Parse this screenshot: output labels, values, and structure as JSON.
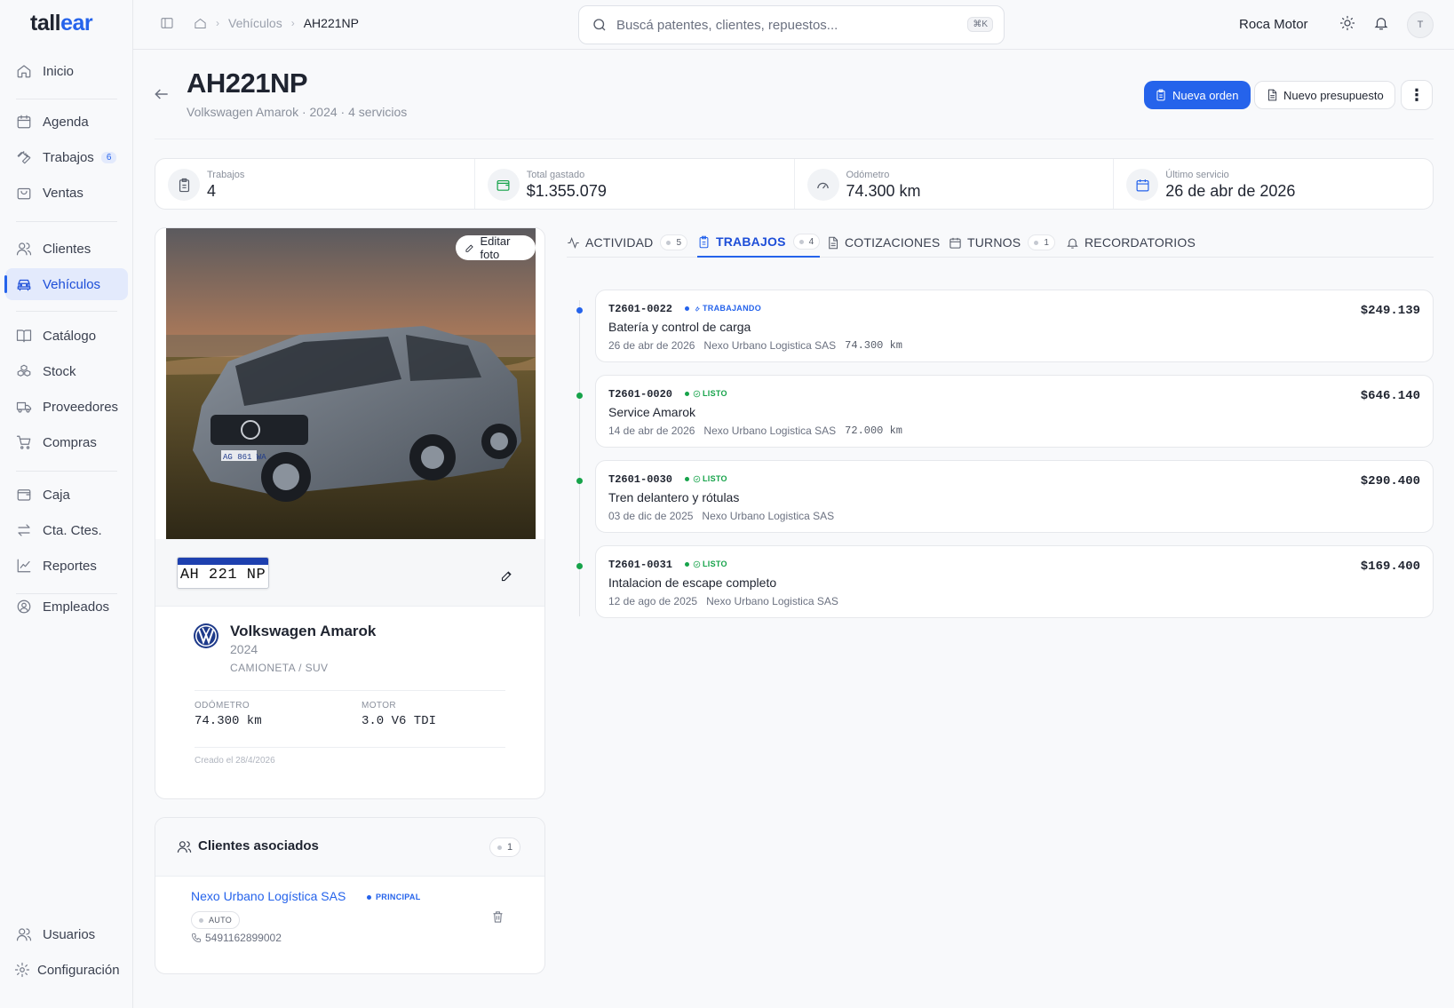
{
  "app": {
    "logo_main": "tallear",
    "logo_prefix": "tall",
    "logo_accent": "ear"
  },
  "colors": {
    "accent": "#2563eb",
    "success": "#16a34a",
    "working": "#2563eb"
  },
  "sidebar": {
    "items": [
      {
        "label": "Inicio",
        "icon": "home-icon"
      },
      {
        "label": "Agenda",
        "icon": "calendar-icon"
      },
      {
        "label": "Trabajos",
        "icon": "wrench-icon",
        "badge": "6"
      },
      {
        "label": "Ventas",
        "icon": "bag-icon"
      },
      {
        "label": "Clientes",
        "icon": "users-icon"
      },
      {
        "label": "Vehículos",
        "icon": "car-icon",
        "active": true
      },
      {
        "label": "Catálogo",
        "icon": "book-icon"
      },
      {
        "label": "Stock",
        "icon": "boxes-icon"
      },
      {
        "label": "Proveedores",
        "icon": "truck-icon"
      },
      {
        "label": "Compras",
        "icon": "cart-icon"
      },
      {
        "label": "Caja",
        "icon": "wallet-icon"
      },
      {
        "label": "Cta. Ctes.",
        "icon": "arrows-icon"
      },
      {
        "label": "Reportes",
        "icon": "chart-icon"
      },
      {
        "label": "Empleados",
        "icon": "user-circle-icon"
      },
      {
        "label": "Usuarios",
        "icon": "users-icon"
      },
      {
        "label": "Configuración",
        "icon": "gear-icon"
      }
    ]
  },
  "topbar": {
    "breadcrumb": {
      "section": "Vehículos",
      "current": "AH221NP"
    },
    "search": {
      "placeholder": "Buscá patentes, clientes, repuestos...",
      "shortcut": "⌘K"
    },
    "workshop": "Roca Motor",
    "avatar_initial": "T"
  },
  "header": {
    "title": "AH221NP",
    "subtitle": "Volkswagen Amarok · 2024 · 4 servicios",
    "new_order": "Nueva orden",
    "new_quote": "Nuevo presupuesto",
    "more": "⋮"
  },
  "stats": [
    {
      "label": "Trabajos",
      "value": "4",
      "icon": "clipboard-icon"
    },
    {
      "label": "Total gastado",
      "value": "$1.355.079",
      "icon": "wallet-icon"
    },
    {
      "label": "Odómetro",
      "value": "74.300 km",
      "icon": "gauge-icon"
    },
    {
      "label": "Último servicio",
      "value": "26 de abr de 2026",
      "icon": "calendar-icon"
    }
  ],
  "vehicle": {
    "edit_photo": "Editar foto",
    "plate": "AH 221 NP",
    "plate_header": "REPÚBLICA ARGENTINA",
    "photo_plate": "AG 861 WA",
    "brand_logo": "volkswagen-logo",
    "name": "Volkswagen Amarok",
    "year": "2024",
    "type": "CAMIONETA / SUV",
    "odometer_label": "ODÓMETRO",
    "odometer_value": "74.300 km",
    "engine_label": "MOTOR",
    "engine_value": "3.0 V6 TDI",
    "created": "Creado el 28/4/2026"
  },
  "clients": {
    "title": "Clientes asociados",
    "count": "1",
    "items": [
      {
        "name": "Nexo Urbano Logística SAS",
        "badge": "PRINCIPAL",
        "tag": "AUTO",
        "phone": "5491162899002"
      }
    ]
  },
  "tabs": [
    {
      "label": "ACTIVIDAD",
      "count": "5",
      "icon": "activity-icon"
    },
    {
      "label": "TRABAJOS",
      "count": "4",
      "icon": "clipboard-icon",
      "active": true
    },
    {
      "label": "COTIZACIONES",
      "icon": "document-icon"
    },
    {
      "label": "TURNOS",
      "count": "1",
      "icon": "calendar-icon"
    },
    {
      "label": "RECORDATORIOS",
      "icon": "bell-icon"
    }
  ],
  "jobs": [
    {
      "code": "T2601-0022",
      "status": "TRABAJANDO",
      "status_type": "working",
      "title": "Batería y control de carga",
      "date": "26 de abr de 2026",
      "client": "Nexo Urbano Logistica SAS",
      "km": "74.300 km",
      "amount": "$249.139"
    },
    {
      "code": "T2601-0020",
      "status": "LISTO",
      "status_type": "done",
      "title": "Service Amarok",
      "date": "14 de abr de 2026",
      "client": "Nexo Urbano Logistica SAS",
      "km": "72.000 km",
      "amount": "$646.140"
    },
    {
      "code": "T2601-0030",
      "status": "LISTO",
      "status_type": "done",
      "title": "Tren delantero y rótulas",
      "date": "03 de dic de 2025",
      "client": "Nexo Urbano Logistica SAS",
      "km": "",
      "amount": "$290.400"
    },
    {
      "code": "T2601-0031",
      "status": "LISTO",
      "status_type": "done",
      "title": "Intalacion de escape completo",
      "date": "12 de ago de 2025",
      "client": "Nexo Urbano Logistica SAS",
      "km": "",
      "amount": "$169.400"
    }
  ]
}
